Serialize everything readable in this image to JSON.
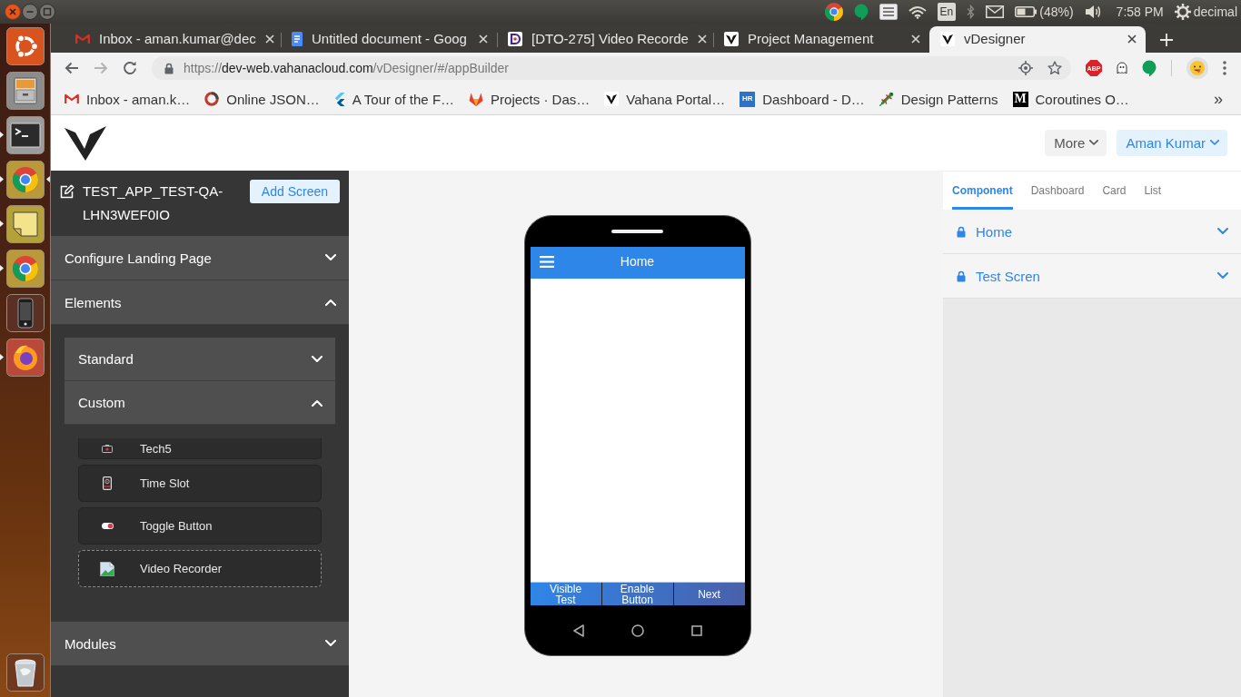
{
  "desktop": {
    "launcher": [
      {
        "kind": "dash",
        "running": false,
        "focused": false
      },
      {
        "kind": "files",
        "running": false,
        "focused": false
      },
      {
        "kind": "terminal",
        "running": true,
        "focused": false
      },
      {
        "kind": "chrome",
        "running": true,
        "focused": true
      },
      {
        "kind": "notes",
        "running": true,
        "focused": false
      },
      {
        "kind": "chrome",
        "running": true,
        "focused": false
      },
      {
        "kind": "phone",
        "running": false,
        "focused": false
      },
      {
        "kind": "firefox",
        "running": true,
        "focused": false
      },
      {
        "kind": "trash",
        "running": false,
        "focused": false
      }
    ],
    "tray": {
      "keyboard_layout": "En",
      "battery": "(48%)",
      "clock": "7:58 PM",
      "user": "decimal"
    }
  },
  "browser": {
    "tabs": [
      {
        "title": "Inbox - aman.kumar@dec",
        "kind": "mail",
        "selected": false
      },
      {
        "title": "Untitled document - Goog",
        "kind": "doc",
        "selected": false
      },
      {
        "title": "[DTO-275] Video Recorde",
        "kind": "dlogo",
        "selected": false
      },
      {
        "title": "Project Management",
        "kind": "v",
        "selected": false
      },
      {
        "title": "vDesigner",
        "kind": "v",
        "selected": true
      }
    ],
    "url": {
      "scheme": "https://",
      "host": "dev-web.vahanacloud.com",
      "path": "/vDesigner/#/appBuilder"
    },
    "extension_label": "ABP",
    "bookmarks": [
      {
        "label": "Inbox - aman.k…",
        "kind": "mail"
      },
      {
        "label": "Online JSON…",
        "kind": "ring"
      },
      {
        "label": "A Tour of the F…",
        "kind": "chevrons"
      },
      {
        "label": "Projects · Das…",
        "kind": "fox"
      },
      {
        "label": "Vahana Portal…",
        "kind": "v"
      },
      {
        "label": "Dashboard - D…",
        "kind": "badge",
        "badge": "HR",
        "color": "#2d72c4"
      },
      {
        "label": "Design Patterns",
        "kind": "lizard"
      },
      {
        "label": "Coroutines O…",
        "kind": "letter",
        "badge": "M",
        "color": "#000000"
      }
    ],
    "bookmarks_overflow": "»"
  },
  "app": {
    "header": {
      "menus": [
        {
          "label": "More",
          "kind": "plain"
        },
        {
          "label": "Aman Kumar",
          "kind": "account"
        }
      ]
    },
    "left_panel": {
      "app_name": "TEST_APP_TEST-QA-LHN3WEF0IO",
      "add_button": "Add Screen",
      "sections": [
        {
          "label": "Configure Landing Page",
          "expanded": false
        },
        {
          "label": "Elements",
          "expanded": true,
          "groups": [
            {
              "label": "Standard",
              "expanded": false
            },
            {
              "label": "Custom",
              "expanded": true,
              "items": [
                {
                  "label": "Tech5",
                  "kind": "camera",
                  "dragging": false
                },
                {
                  "label": "Time Slot",
                  "kind": "device",
                  "dragging": false
                },
                {
                  "label": "Toggle Button",
                  "kind": "toggle",
                  "dragging": false
                },
                {
                  "label": "Video Recorder",
                  "kind": "image",
                  "dragging": true
                }
              ]
            }
          ]
        },
        {
          "label": "Modules",
          "expanded": false
        }
      ]
    },
    "phone": {
      "title": "Home",
      "buttons": [
        "Visible Test",
        "Enable Button",
        "Next"
      ]
    },
    "right_panel": {
      "tabs": [
        {
          "label": "Component",
          "selected": true
        },
        {
          "label": "Dashboard",
          "selected": false
        },
        {
          "label": "Card",
          "selected": false
        },
        {
          "label": "List",
          "selected": false
        }
      ],
      "screens": [
        {
          "label": "Home",
          "locked": true,
          "expanded": false
        },
        {
          "label": "Test Scren",
          "locked": true,
          "expanded": false
        }
      ]
    }
  }
}
